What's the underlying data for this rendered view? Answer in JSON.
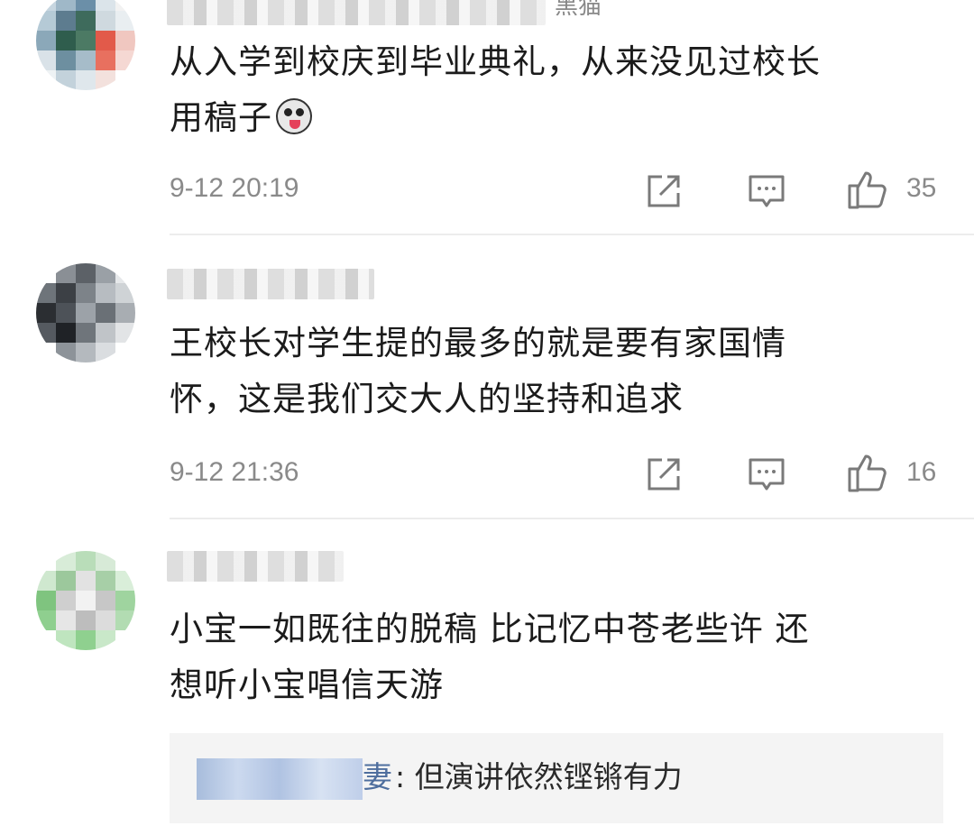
{
  "comments": [
    {
      "username_tail": "黑猫",
      "text_line1": "从入学到校庆到毕业典礼，从来没见过校长",
      "text_line2": "用稿子",
      "time": "9-12 20:19",
      "likes": "35",
      "avatar_colors": [
        "#c7d6e0",
        "#9fb8c8",
        "#6b8fa8",
        "#dbe4ea",
        "#f2f2f2",
        "#b5cad6",
        "#5d7c8f",
        "#3e6b5c",
        "#cfd9df",
        "#e9eef1",
        "#8ba8b9",
        "#2f5d4d",
        "#4c7a64",
        "#e25a4a",
        "#f0c7c0",
        "#d9e2e8",
        "#6d8fa0",
        "#a6bcc9",
        "#e8705f",
        "#f5d8d3",
        "#eef2f4",
        "#c3d2db",
        "#dfe7ec",
        "#f3e1dd",
        "#ffffff"
      ]
    },
    {
      "username_tail": "",
      "text_line1": "王校长对学生提的最多的就是要有家国情",
      "text_line2": "怀，这是我们交大人的坚持和追求",
      "time": "9-12 21:36",
      "likes": "16",
      "avatar_colors": [
        "#ffffff",
        "#8a8f95",
        "#5c6167",
        "#9aa0a6",
        "#e6e8ea",
        "#6e747a",
        "#3c4045",
        "#7d8389",
        "#b7bcc1",
        "#cfd3d6",
        "#2b2e32",
        "#4d5258",
        "#9ca2a8",
        "#6a7076",
        "#a8adb2",
        "#555a60",
        "#1f2226",
        "#6f757b",
        "#c0c4c8",
        "#e2e4e6",
        "#ffffff",
        "#8d9399",
        "#b4b9be",
        "#dadde0",
        "#ffffff"
      ]
    },
    {
      "username_tail": "",
      "text_line1": "小宝一如既往的脱稿  比记忆中苍老些许  还",
      "text_line2": "想听小宝唱信天游",
      "avatar_colors": [
        "#ffffff",
        "#d8ecd8",
        "#b9ddb9",
        "#d7ead7",
        "#ffffff",
        "#cfe8cf",
        "#9cc89c",
        "#e2e2e2",
        "#a7cfa7",
        "#d9eed9",
        "#7fc47f",
        "#cfcfcf",
        "#f2f2f2",
        "#c7c7c7",
        "#9fd49f",
        "#8fcf8f",
        "#e6e6e6",
        "#bdbdbd",
        "#dcdcdc",
        "#b2dcb2",
        "#ffffff",
        "#bfe5bf",
        "#8fd08f",
        "#c9e8c9",
        "#ffffff"
      ],
      "reply": {
        "author_tail": "妻",
        "text": ": 但演讲依然铿锵有力"
      }
    }
  ]
}
